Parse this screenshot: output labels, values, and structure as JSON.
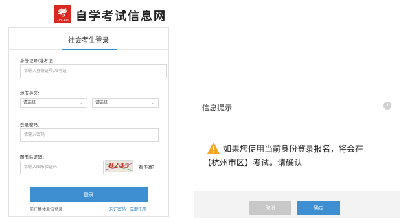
{
  "header": {
    "logo_badge": "考",
    "logo_sub": "ZEKAO",
    "site_name": "自学考试信息网"
  },
  "login": {
    "tab": "社会考生登录",
    "id_label": "身份证号/准考证：",
    "id_placeholder": "请输入身份证号/准考证",
    "district_label": "地市县区：",
    "city_select": "请选择",
    "county_select": "请选择",
    "password_label": "登录密码：",
    "password_placeholder": "请输入密码",
    "captcha_label": "图形验证码：",
    "captcha_placeholder": "请输入图形验证码",
    "captcha_text": "8245",
    "refresh_link": "看不清？",
    "login_button": "登录",
    "group_login_link": "前往集体单位登录",
    "forgot_link": "忘记密码",
    "register_link": "立即注册"
  },
  "dialog": {
    "title": "信息提示",
    "message_line1": "如果您使用当前身份登录报名，将会在",
    "message_line2": "【杭州市区】考试。请确认",
    "cancel_button": "取消",
    "ok_button": "确定"
  },
  "colors": {
    "accent": "#3d8fd2",
    "warning": "#f5a623",
    "logo_red": "#d9281f"
  }
}
